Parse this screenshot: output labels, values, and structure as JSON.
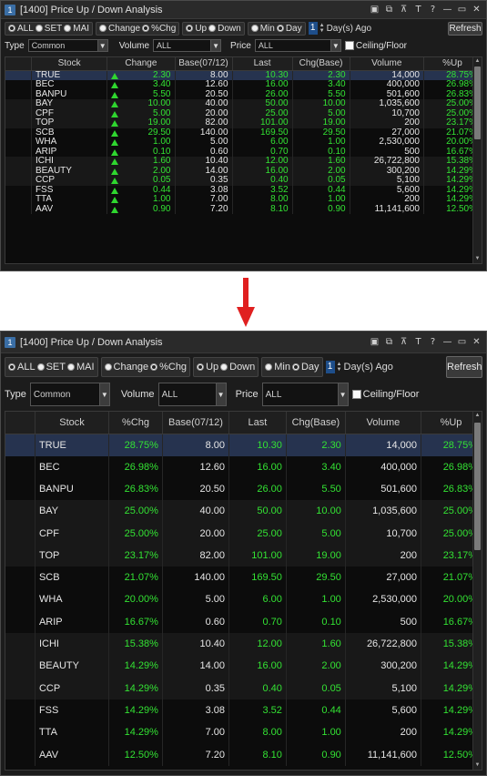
{
  "window": {
    "icon_text": "1",
    "title": "[1400] Price Up / Down Analysis"
  },
  "title_buttons": [
    "▣",
    "⧉",
    "⊼",
    "T",
    "?",
    "—",
    "▭",
    "✕"
  ],
  "market_radios": [
    {
      "label": "ALL",
      "checked": true
    },
    {
      "label": "SET",
      "checked": false
    },
    {
      "label": "MAI",
      "checked": false
    }
  ],
  "sort_radios": [
    {
      "label": "Change",
      "checked": false
    },
    {
      "label": "%Chg",
      "checked": true
    }
  ],
  "dir_radios": [
    {
      "label": "Up",
      "checked": true
    },
    {
      "label": "Down",
      "checked": false
    }
  ],
  "period_radios": [
    {
      "label": "Min",
      "checked": false
    },
    {
      "label": "Day",
      "checked": true
    }
  ],
  "days": {
    "value": "1",
    "label": "Day(s) Ago"
  },
  "refresh_label": "Refresh",
  "filters": {
    "type_label": "Type",
    "type_value": "Common",
    "volume_label": "Volume",
    "volume_value": "ALL",
    "price_label": "Price",
    "price_value": "ALL",
    "ceiling_label": "Ceiling/Floor"
  },
  "grid1": {
    "columns": [
      "Stock",
      "Change",
      "Base(07/12)",
      "Last",
      "Chg(Base)",
      "Volume",
      "%Up"
    ],
    "rows": [
      {
        "stock": "TRUE",
        "change": "2.30",
        "base": "8.00",
        "last": "10.30",
        "chgbase": "2.30",
        "volume": "14,000",
        "up": "28.75%"
      },
      {
        "stock": "BEC",
        "change": "3.40",
        "base": "12.60",
        "last": "16.00",
        "chgbase": "3.40",
        "volume": "400,000",
        "up": "26.98%"
      },
      {
        "stock": "BANPU",
        "change": "5.50",
        "base": "20.50",
        "last": "26.00",
        "chgbase": "5.50",
        "volume": "501,600",
        "up": "26.83%"
      },
      {
        "stock": "BAY",
        "change": "10.00",
        "base": "40.00",
        "last": "50.00",
        "chgbase": "10.00",
        "volume": "1,035,600",
        "up": "25.00%"
      },
      {
        "stock": "CPF",
        "change": "5.00",
        "base": "20.00",
        "last": "25.00",
        "chgbase": "5.00",
        "volume": "10,700",
        "up": "25.00%"
      },
      {
        "stock": "TOP",
        "change": "19.00",
        "base": "82.00",
        "last": "101.00",
        "chgbase": "19.00",
        "volume": "200",
        "up": "23.17%"
      },
      {
        "stock": "SCB",
        "change": "29.50",
        "base": "140.00",
        "last": "169.50",
        "chgbase": "29.50",
        "volume": "27,000",
        "up": "21.07%"
      },
      {
        "stock": "WHA",
        "change": "1.00",
        "base": "5.00",
        "last": "6.00",
        "chgbase": "1.00",
        "volume": "2,530,000",
        "up": "20.00%"
      },
      {
        "stock": "ARIP",
        "change": "0.10",
        "base": "0.60",
        "last": "0.70",
        "chgbase": "0.10",
        "volume": "500",
        "up": "16.67%"
      },
      {
        "stock": "ICHI",
        "change": "1.60",
        "base": "10.40",
        "last": "12.00",
        "chgbase": "1.60",
        "volume": "26,722,800",
        "up": "15.38%"
      },
      {
        "stock": "BEAUTY",
        "change": "2.00",
        "base": "14.00",
        "last": "16.00",
        "chgbase": "2.00",
        "volume": "300,200",
        "up": "14.29%"
      },
      {
        "stock": "CCP",
        "change": "0.05",
        "base": "0.35",
        "last": "0.40",
        "chgbase": "0.05",
        "volume": "5,100",
        "up": "14.29%"
      },
      {
        "stock": "FSS",
        "change": "0.44",
        "base": "3.08",
        "last": "3.52",
        "chgbase": "0.44",
        "volume": "5,600",
        "up": "14.29%"
      },
      {
        "stock": "TTA",
        "change": "1.00",
        "base": "7.00",
        "last": "8.00",
        "chgbase": "1.00",
        "volume": "200",
        "up": "14.29%"
      },
      {
        "stock": "AAV",
        "change": "0.90",
        "base": "7.20",
        "last": "8.10",
        "chgbase": "0.90",
        "volume": "11,141,600",
        "up": "12.50%"
      }
    ]
  },
  "grid2": {
    "columns": [
      "Stock",
      "%Chg",
      "Base(07/12)",
      "Last",
      "Chg(Base)",
      "Volume",
      "%Up"
    ],
    "rows": [
      {
        "stock": "TRUE",
        "pchg": "28.75%",
        "base": "8.00",
        "last": "10.30",
        "chgbase": "2.30",
        "volume": "14,000",
        "up": "28.75%"
      },
      {
        "stock": "BEC",
        "pchg": "26.98%",
        "base": "12.60",
        "last": "16.00",
        "chgbase": "3.40",
        "volume": "400,000",
        "up": "26.98%"
      },
      {
        "stock": "BANPU",
        "pchg": "26.83%",
        "base": "20.50",
        "last": "26.00",
        "chgbase": "5.50",
        "volume": "501,600",
        "up": "26.83%"
      },
      {
        "stock": "BAY",
        "pchg": "25.00%",
        "base": "40.00",
        "last": "50.00",
        "chgbase": "10.00",
        "volume": "1,035,600",
        "up": "25.00%"
      },
      {
        "stock": "CPF",
        "pchg": "25.00%",
        "base": "20.00",
        "last": "25.00",
        "chgbase": "5.00",
        "volume": "10,700",
        "up": "25.00%"
      },
      {
        "stock": "TOP",
        "pchg": "23.17%",
        "base": "82.00",
        "last": "101.00",
        "chgbase": "19.00",
        "volume": "200",
        "up": "23.17%"
      },
      {
        "stock": "SCB",
        "pchg": "21.07%",
        "base": "140.00",
        "last": "169.50",
        "chgbase": "29.50",
        "volume": "27,000",
        "up": "21.07%"
      },
      {
        "stock": "WHA",
        "pchg": "20.00%",
        "base": "5.00",
        "last": "6.00",
        "chgbase": "1.00",
        "volume": "2,530,000",
        "up": "20.00%"
      },
      {
        "stock": "ARIP",
        "pchg": "16.67%",
        "base": "0.60",
        "last": "0.70",
        "chgbase": "0.10",
        "volume": "500",
        "up": "16.67%"
      },
      {
        "stock": "ICHI",
        "pchg": "15.38%",
        "base": "10.40",
        "last": "12.00",
        "chgbase": "1.60",
        "volume": "26,722,800",
        "up": "15.38%"
      },
      {
        "stock": "BEAUTY",
        "pchg": "14.29%",
        "base": "14.00",
        "last": "16.00",
        "chgbase": "2.00",
        "volume": "300,200",
        "up": "14.29%"
      },
      {
        "stock": "CCP",
        "pchg": "14.29%",
        "base": "0.35",
        "last": "0.40",
        "chgbase": "0.05",
        "volume": "5,100",
        "up": "14.29%"
      },
      {
        "stock": "FSS",
        "pchg": "14.29%",
        "base": "3.08",
        "last": "3.52",
        "chgbase": "0.44",
        "volume": "5,600",
        "up": "14.29%"
      },
      {
        "stock": "TTA",
        "pchg": "14.29%",
        "base": "7.00",
        "last": "8.00",
        "chgbase": "1.00",
        "volume": "200",
        "up": "14.29%"
      },
      {
        "stock": "AAV",
        "pchg": "12.50%",
        "base": "7.20",
        "last": "8.10",
        "chgbase": "0.90",
        "volume": "11,141,600",
        "up": "12.50%"
      }
    ]
  },
  "colors": {
    "up_green": "#33e233",
    "arrow_red": "#e02020",
    "selected_row": "#26334f"
  }
}
